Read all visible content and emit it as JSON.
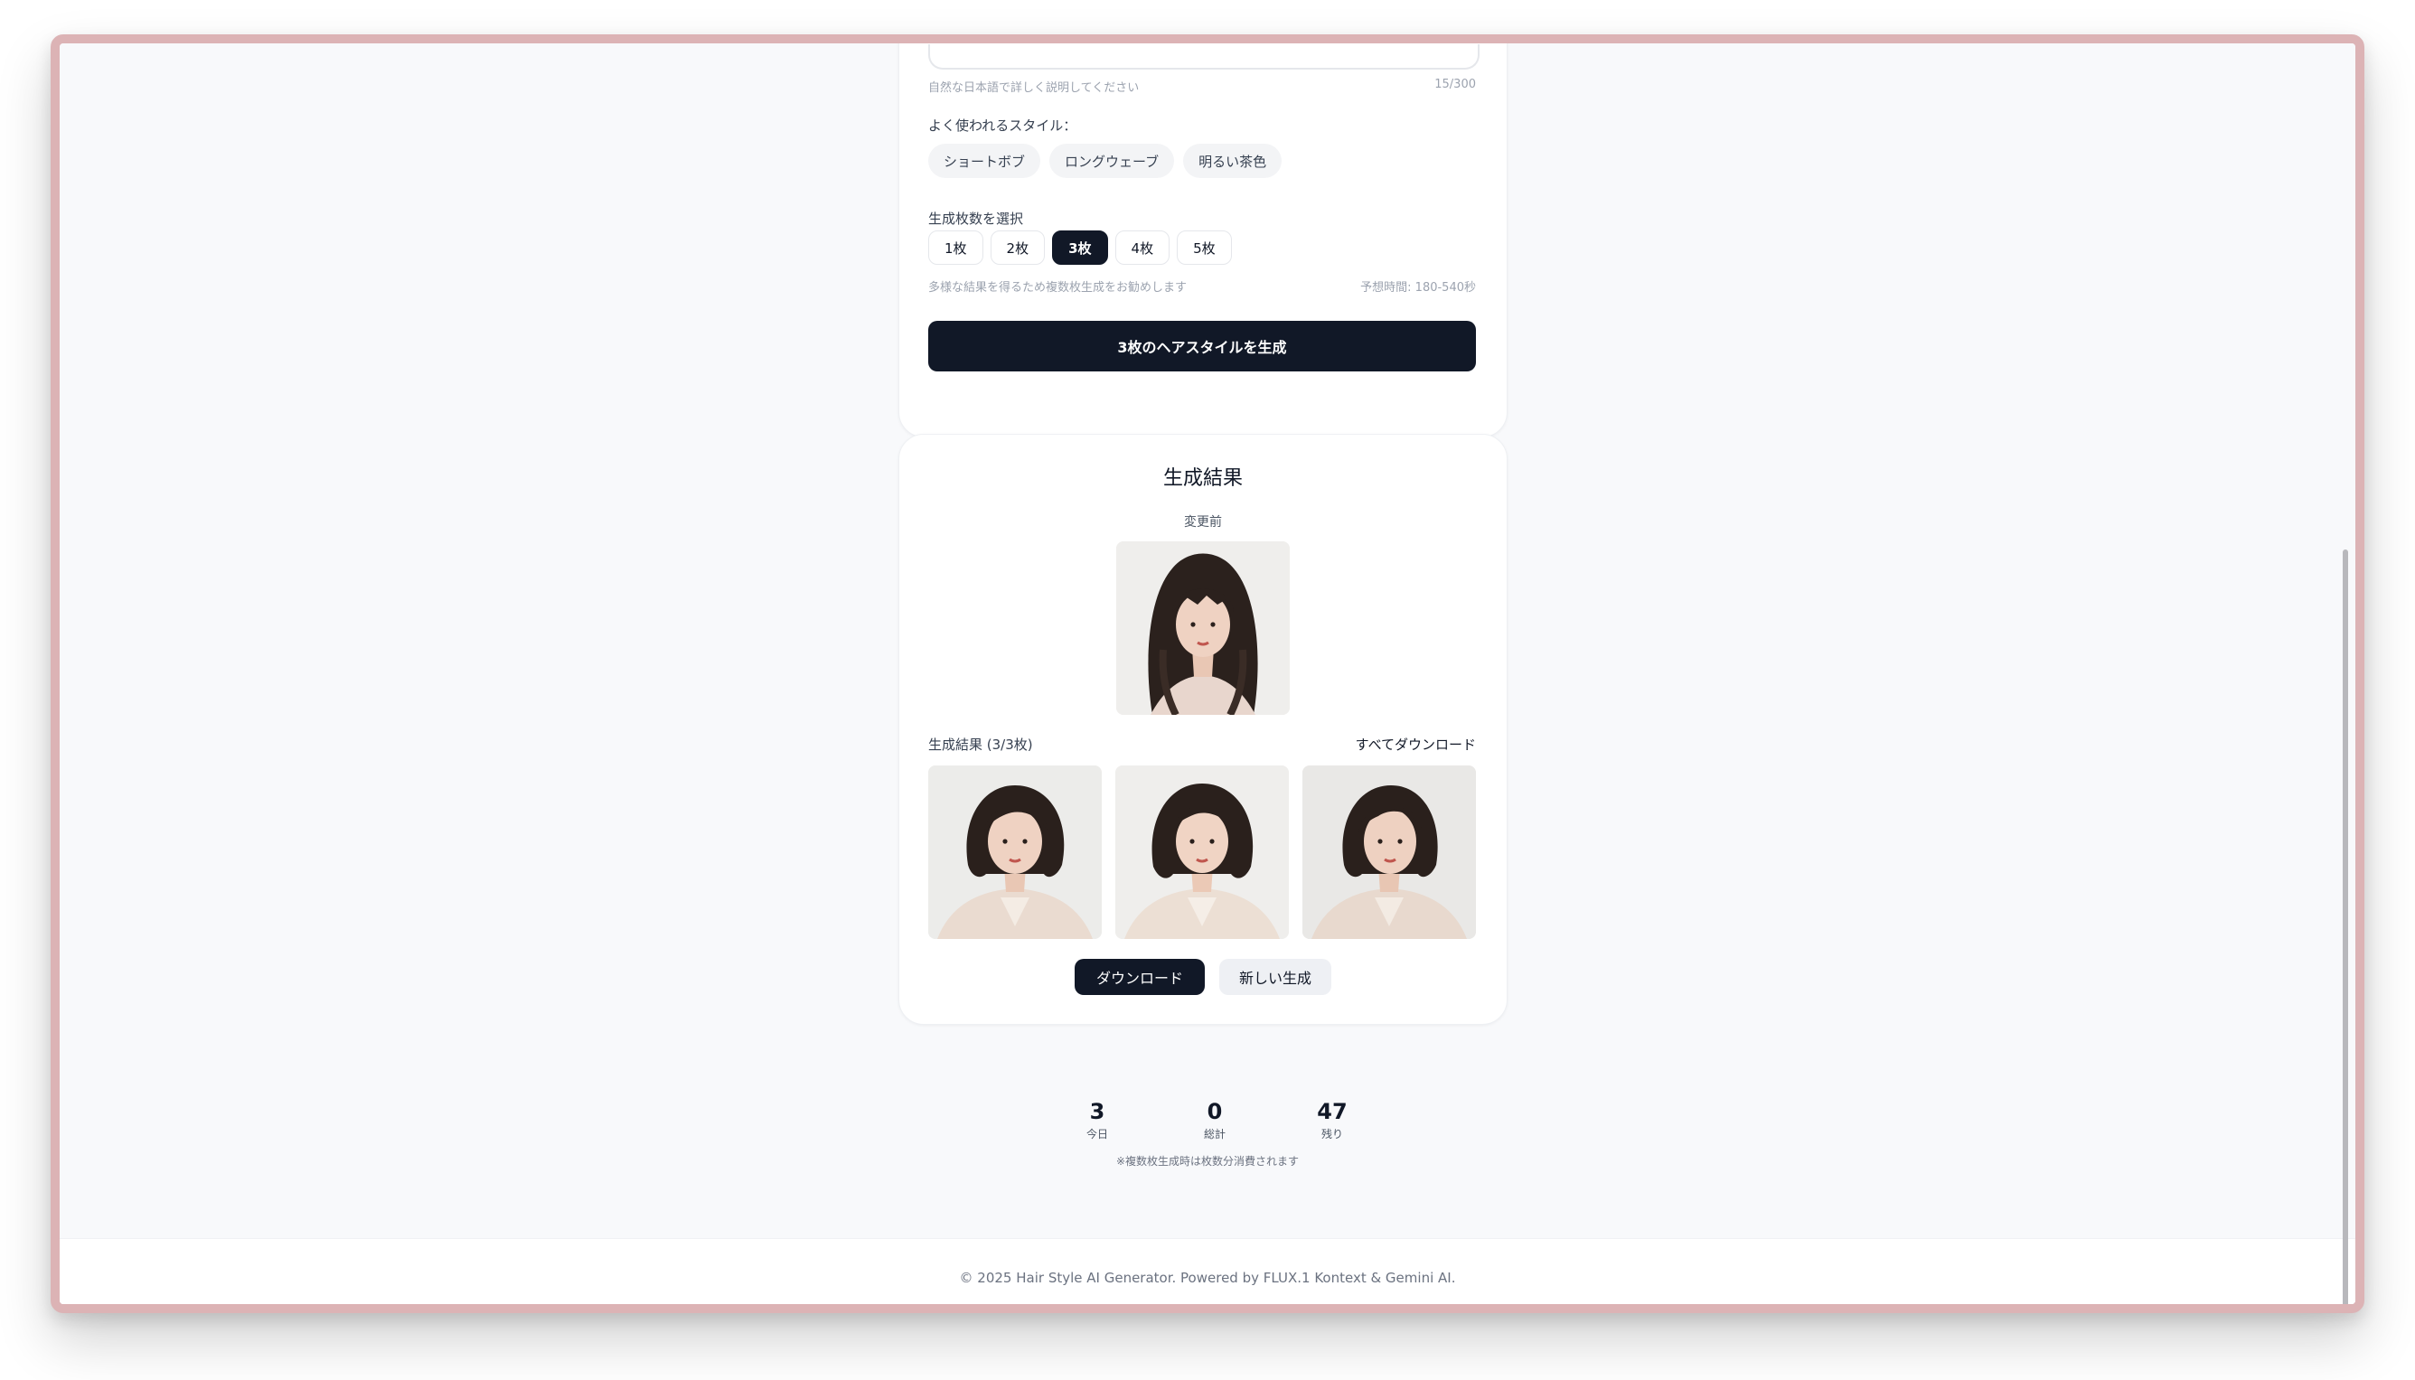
{
  "prompt_area": {
    "hint": "自然な日本語で詳しく説明してください",
    "char_count": "15/300",
    "popular_label": "よく使われるスタイル：",
    "popular_styles": [
      "ショートボブ",
      "ロングウェーブ",
      "明るい茶色"
    ]
  },
  "generation_count": {
    "label": "生成枚数を選択",
    "options": [
      "1枚",
      "2枚",
      "3枚",
      "4枚",
      "5枚"
    ],
    "selected": "3枚",
    "recommendation": "多様な結果を得るため複数枚生成をお勧めします",
    "estimated_time": "予想時間: 180-540秒"
  },
  "generate_button": "3枚のヘアスタイルを生成",
  "results": {
    "title": "生成結果",
    "before_label": "変更前",
    "results_label": "生成結果 (3/3枚)",
    "download_all": "すべてダウンロード",
    "download_button": "ダウンロード",
    "new_generation_button": "新しい生成"
  },
  "stats": {
    "today_value": "3",
    "today_label": "今日",
    "total_value": "0",
    "total_label": "総計",
    "remaining_value": "47",
    "remaining_label": "残り",
    "note": "※複数枚生成時は枚数分消費されます"
  },
  "footer": "© 2025 Hair Style AI Generator. Powered by FLUX.1 Kontext & Gemini AI."
}
